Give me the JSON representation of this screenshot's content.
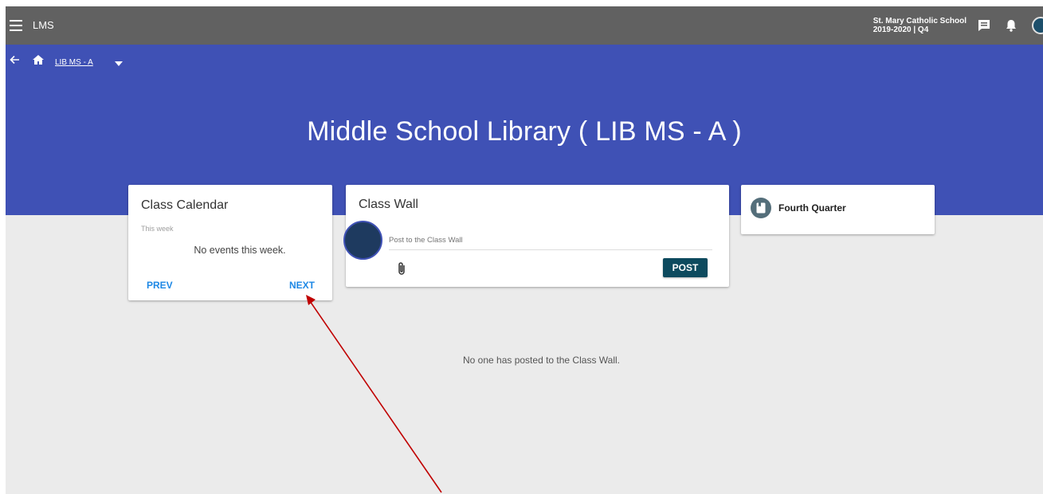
{
  "topbar": {
    "app_name": "LMS",
    "school_name": "St. Mary Catholic School",
    "term": "2019-2020 | Q4",
    "icons": [
      "menu-icon",
      "chat-icon",
      "bell-icon",
      "avatar"
    ]
  },
  "breadcrumb": {
    "course_code": "LIB MS - A"
  },
  "page": {
    "title": "Middle School Library ( LIB MS - A )"
  },
  "calendar": {
    "title": "Class Calendar",
    "subtitle": "This week",
    "empty": "No events this week.",
    "prev_label": "PREV",
    "next_label": "NEXT"
  },
  "wall": {
    "title": "Class Wall",
    "placeholder": "Post to the Class Wall",
    "post_label": "POST",
    "empty": "No one has posted to the Class Wall."
  },
  "quarter": {
    "label": "Fourth Quarter"
  },
  "colors": {
    "topbar": "#616161",
    "hero": "#3f51b5",
    "accent_link": "#1e88e5",
    "post_button": "#0d4a5e",
    "annotation_arrow": "#c00000"
  }
}
